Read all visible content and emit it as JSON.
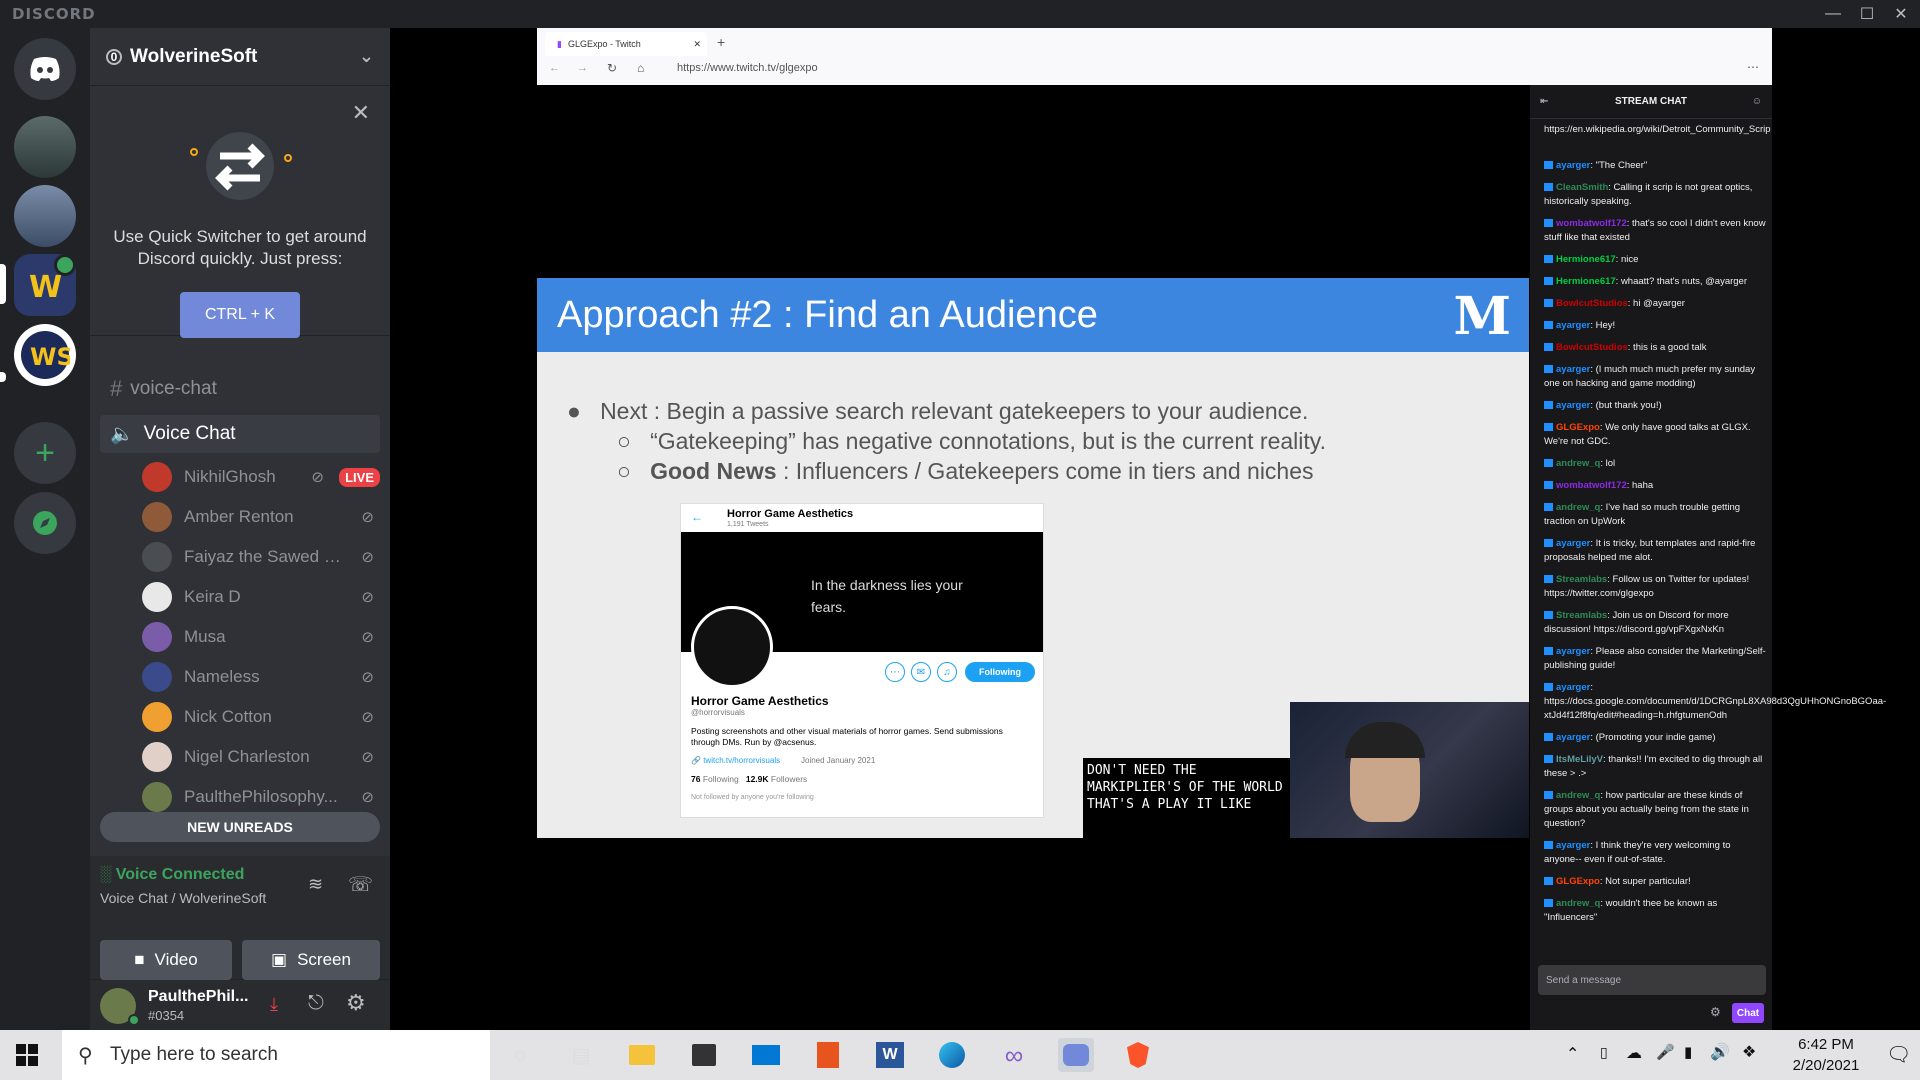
{
  "window": {
    "brand": "DISCORD"
  },
  "servers": [
    {
      "name": "home"
    },
    {
      "name": "server-1"
    },
    {
      "name": "server-2"
    },
    {
      "name": "WolverineSoft"
    },
    {
      "name": "WolverineSoft-active"
    }
  ],
  "guild": {
    "badge": "0",
    "name": "WolverineSoft"
  },
  "quick_switcher": {
    "text": "Use Quick Switcher to get around Discord quickly. Just press:",
    "button": "CTRL + K"
  },
  "channels": {
    "text_channel": "voice-chat",
    "voice_channel": "Voice Chat"
  },
  "voice_users": [
    {
      "name": "NikhilGhosh",
      "live": "LIVE",
      "color": "#c0392b"
    },
    {
      "name": "Amber Renton",
      "color": "#8e5a3a"
    },
    {
      "name": "Faiyaz the Sawed of...",
      "color": "#4a4d52"
    },
    {
      "name": "Keira D",
      "color": "#e8e8e8"
    },
    {
      "name": "Musa",
      "color": "#7a5ca8"
    },
    {
      "name": "Nameless",
      "color": "#3a4a8a"
    },
    {
      "name": "Nick Cotton",
      "color": "#f0a030"
    },
    {
      "name": "Nigel Charleston",
      "color": "#e0d0c8"
    },
    {
      "name": "PaulthePhilosophy...",
      "color": "#6a7a4a"
    }
  ],
  "new_unreads": "NEW UNREADS",
  "voice_connected": {
    "status": "Voice Connected",
    "location": "Voice Chat / WolverineSoft",
    "video": "Video",
    "screen": "Screen"
  },
  "user": {
    "name": "PaulthePhil...",
    "tag": "#0354"
  },
  "browser": {
    "tab_title": "GLGExpo - Twitch",
    "url": "https://www.twitch.tv/glgexpo"
  },
  "slide": {
    "title": "Approach #2 : Find an Audience",
    "bullet1": "Next : Begin a passive search relevant gatekeepers to your audience.",
    "sub1": "“Gatekeeping” has negative connotations, but is the current reality.",
    "sub2_bold": "Good News",
    "sub2_rest": " : Influencers / Gatekeepers come in tiers and niches",
    "twitter": {
      "header_name": "Horror Game Aesthetics",
      "header_count": "1,191 Tweets",
      "banner_text": "In the darkness lies your fears.",
      "follow": "Following",
      "name": "Horror Game Aesthetics",
      "handle": "@horrorvisuals",
      "bio": "Posting screenshots and other visual materials of horror games. Send submissions through DMs. Run by @acsenus.",
      "link": "twitch.tv/horrorvisuals",
      "joined": "Joined January 2021",
      "following_count": "76",
      "following_label": "Following",
      "followers_count": "12.9K",
      "followers_label": "Followers",
      "note": "Not followed by anyone you're following"
    }
  },
  "caption": "DON'T NEED THE MARKIPLIER'S OF THE WORLD THAT'S A PLAY IT LIKE",
  "chat": {
    "header": "STREAM CHAT",
    "messages": [
      {
        "user": "",
        "text": "https://en.wikipedia.org/wiki/Detroit_Community_Scrip",
        "color": "#5b9bd5"
      },
      {
        "user": "ayarger",
        "text": ": \"The Cheer\"",
        "color": "#1e90ff"
      },
      {
        "user": "CleanSmith",
        "text": ": Calling it scrip is not great optics, historically speaking.",
        "color": "#2e8b57"
      },
      {
        "user": "wombatwolf172",
        "text": ": that's so cool I didn't even know stuff like that existed",
        "color": "#8a2be2"
      },
      {
        "user": "Hermione617",
        "text": ": nice",
        "color": "#00cc44"
      },
      {
        "user": "Hermione617",
        "text": ": whaatt? that's nuts, @ayarger",
        "color": "#00cc44"
      },
      {
        "user": "BowlcutStudios",
        "text": ": hi @ayarger",
        "color": "#cc0000"
      },
      {
        "user": "ayarger",
        "text": ": Hey!",
        "color": "#1e90ff"
      },
      {
        "user": "BowlcutStudios",
        "text": ": this is a good talk",
        "color": "#cc0000"
      },
      {
        "user": "ayarger",
        "text": ": (I much much much prefer my sunday one on hacking and game modding)",
        "color": "#1e90ff"
      },
      {
        "user": "ayarger",
        "text": ": (but thank you!)",
        "color": "#1e90ff"
      },
      {
        "user": "GLGExpo",
        "text": ": We only have good talks at GLGX. We're not GDC.",
        "color": "#ff4500"
      },
      {
        "user": "andrew_q",
        "text": ": lol",
        "color": "#2e8b57"
      },
      {
        "user": "wombatwolf172",
        "text": ": haha",
        "color": "#8a2be2"
      },
      {
        "user": "andrew_q",
        "text": ": I've had so much trouble getting traction on UpWork",
        "color": "#2e8b57"
      },
      {
        "user": "ayarger",
        "text": ": It is tricky, but templates and rapid-fire proposals helped me alot.",
        "color": "#1e90ff"
      },
      {
        "user": "Streamlabs",
        "text": ": Follow us on Twitter for updates! https://twitter.com/glgexpo",
        "color": "#2e8b57"
      },
      {
        "user": "Streamlabs",
        "text": ": Join us on Discord for more discussion! https://discord.gg/vpFXgxNxKn",
        "color": "#2e8b57"
      },
      {
        "user": "ayarger",
        "text": ": Please also consider the Marketing/Self-publishing guide!",
        "color": "#1e90ff"
      },
      {
        "user": "ayarger",
        "text": ": https://docs.google.com/document/d/1DCRGnpL8XA98d3QgUHhONGnoBGOaa-xtJd4f12f8fq/edit#heading=h.rhfgtumenOdh",
        "color": "#1e90ff"
      },
      {
        "user": "ayarger",
        "text": ": (Promoting your indie game)",
        "color": "#1e90ff"
      },
      {
        "user": "ItsMeLilyV",
        "text": ": thanks!! I'm excited to dig through all these > .>",
        "color": "#5f9ea0"
      },
      {
        "user": "andrew_q",
        "text": ": how particular are these kinds of groups about you actually being from the state in question?",
        "color": "#2e8b57"
      },
      {
        "user": "ayarger",
        "text": ": I think they're very welcoming to anyone-- even if out-of-state.",
        "color": "#1e90ff"
      },
      {
        "user": "GLGExpo",
        "text": ": Not super particular!",
        "color": "#ff4500"
      },
      {
        "user": "andrew_q",
        "text": ": wouldn't thee be known as \"Influencers\"",
        "color": "#2e8b57"
      }
    ],
    "input_placeholder": "Send a message",
    "chat_button": "Chat"
  },
  "taskbar": {
    "search_placeholder": "Type here to search",
    "time": "6:42 PM",
    "date": "2/20/2021"
  },
  "colors": {
    "blurple": "#7289da",
    "green": "#3ba55d",
    "twitch": "#9147ff",
    "slide_blue": "#3c86e0"
  }
}
